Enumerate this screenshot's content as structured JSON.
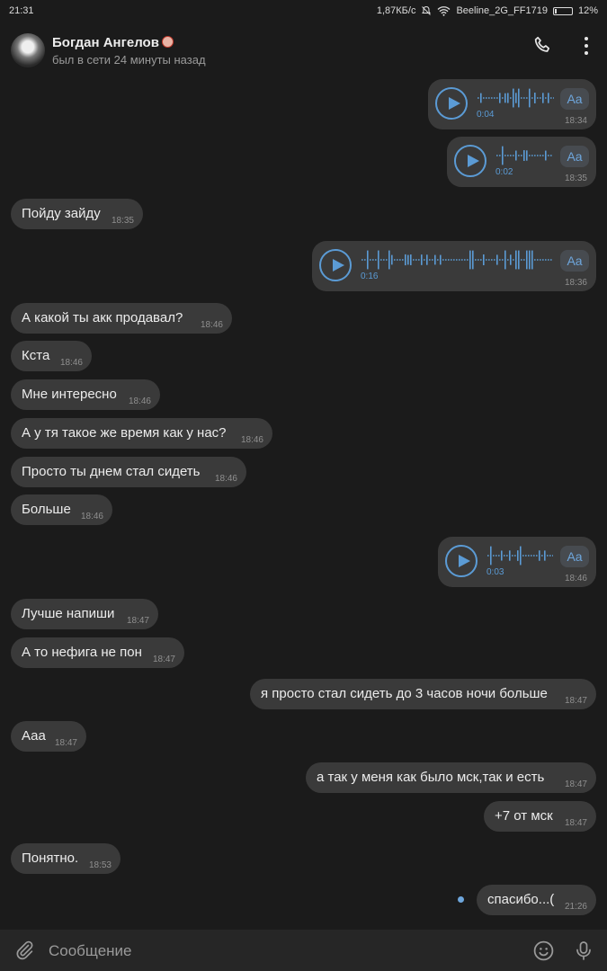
{
  "status_bar": {
    "time": "21:31",
    "speed": "1,87КБ/с",
    "carrier": "Beeline_2G_FF1719",
    "battery": "12%",
    "battery_level": 0.12
  },
  "header": {
    "name": "Богдан Ангелов",
    "name_emoji": "clown-face-icon",
    "last_seen": "был в сети 24 минуты назад"
  },
  "voice_messages": [
    {
      "duration": "0:04",
      "time": "18:34",
      "aa": "Aa"
    },
    {
      "duration": "0:02",
      "time": "18:35",
      "aa": "Aa"
    },
    {
      "duration": "0:16",
      "time": "18:36",
      "aa": "Aa"
    },
    {
      "duration": "0:03",
      "time": "18:46",
      "aa": "Aa"
    }
  ],
  "messages": [
    {
      "text": "Пойду зайду",
      "time": "18:35",
      "out": false
    },
    {
      "text": "А какой ты акк продавал?",
      "time": "18:46",
      "out": false
    },
    {
      "text": "Кста",
      "time": "18:46",
      "out": false
    },
    {
      "text": "Мне интересно",
      "time": "18:46",
      "out": false
    },
    {
      "text": "А у тя такое же время как у нас?",
      "time": "18:46",
      "out": false
    },
    {
      "text": "Просто ты днем стал сидеть",
      "time": "18:46",
      "out": false
    },
    {
      "text": "Больше",
      "time": "18:46",
      "out": false
    },
    {
      "text": "Лучше напиши",
      "time": "18:47",
      "out": false
    },
    {
      "text": "А то нефига не пон",
      "time": "18:47",
      "out": false
    },
    {
      "text": "я просто стал сидеть до 3 часов ночи больше",
      "time": "18:47",
      "out": true
    },
    {
      "text": "Ааа",
      "time": "18:47",
      "out": false
    },
    {
      "text": "а так у меня как было мск,так и есть",
      "time": "18:47",
      "out": true
    },
    {
      "text": "+7 от мск",
      "time": "18:47",
      "out": true
    },
    {
      "text": "Понятно.",
      "time": "18:53",
      "out": false
    },
    {
      "text": "спасибо...(",
      "time": "21:26",
      "out": true,
      "unread": true
    }
  ],
  "composer": {
    "placeholder": "Сообщение"
  },
  "colors": {
    "background": "#1b1b1b",
    "bubble": "#3a3a3a",
    "accent": "#5b9bd5"
  }
}
